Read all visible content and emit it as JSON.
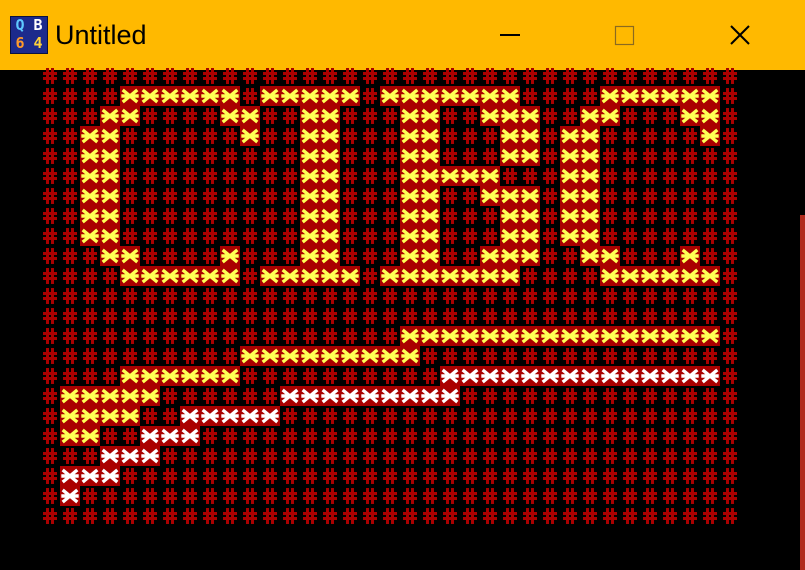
{
  "window": {
    "title": "Untitled",
    "icon": "qb64-app-icon",
    "icon_letters": [
      "Q",
      "B",
      "6",
      "4"
    ],
    "controls": [
      "minimize-icon",
      "maximize-icon",
      "close-icon"
    ]
  },
  "theme": {
    "titlebar": "#ffb900",
    "background": "#000000",
    "hash_color": "#aa0000",
    "yellow": "#ffff55",
    "white": "#ffffff"
  },
  "screen": {
    "columns": 35,
    "rows": 23,
    "fill_glyph": "#",
    "star_glyph": "*",
    "rows_map": [
      "###################################",
      "####******#*****#*******####******#",
      "###**####**##**###**##***##**###**#",
      "##**######*##**###**###**#**#####*#",
      "##**#########**###**###**#**#######",
      "##**#########**###*****###**#######",
      "##**#########**###**##***#**#######",
      "##**#########**###**###**#**#######",
      "##**#########**###**###**#**#######",
      "###**####*###**###**##***##**###*##",
      "####******#*****#*******####******#",
      "###################################",
      "###################################",
      "##################****************#",
      "##########*********################",
      "####******##########WWWWWWWWWWWWWW#",
      "#*****######WWWWWWWWW##############",
      "#****##WWWWW#######################",
      "#**##WWW###########################",
      "###WWW#############################",
      "#WWW###############################",
      "#W#################################",
      "###################################"
    ]
  }
}
